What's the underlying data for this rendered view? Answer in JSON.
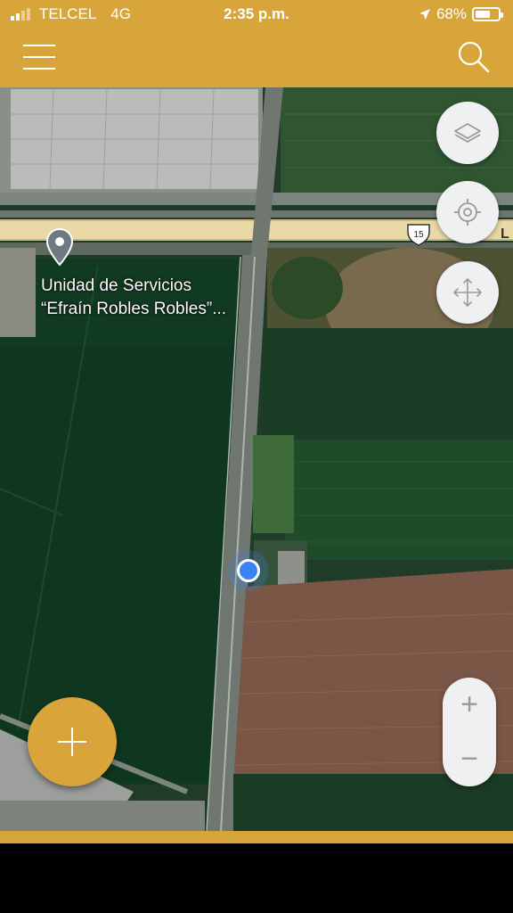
{
  "status_bar": {
    "carrier": "TELCEL",
    "network": "4G",
    "time": "2:35 p.m.",
    "battery_percent": "68%",
    "battery_level": 0.68
  },
  "header": {
    "menu_icon": "hamburger-menu-icon",
    "search_icon": "search-icon",
    "accent_color": "#d7a53a"
  },
  "map": {
    "poi": {
      "line1": "Unidad de Servicios",
      "line2": "“Efraín Robles Robles”..."
    },
    "highway_shield": "15",
    "road_label_partial": "L",
    "controls": {
      "layers_icon": "layers-icon",
      "locate_icon": "crosshair-locate-icon",
      "move_icon": "move-arrows-icon",
      "zoom_in": "+",
      "zoom_out": "−"
    },
    "add_button_icon": "plus-icon"
  }
}
